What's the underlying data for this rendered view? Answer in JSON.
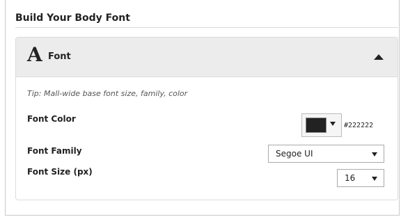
{
  "section": {
    "title": "Build Your Body Font"
  },
  "panel": {
    "icon_glyph": "A",
    "header_label": "Font",
    "tip": "Tip: Mall-wide base font size, family, color"
  },
  "fields": {
    "font_color": {
      "label": "Font Color",
      "value": "#222222"
    },
    "font_family": {
      "label": "Font Family",
      "value": "Segoe UI"
    },
    "font_size": {
      "label": "Font Size (px)",
      "value": "16"
    }
  },
  "icons": {
    "font_icon": "font-icon",
    "collapse": "caret-up-icon",
    "dropdown": "caret-down-icon"
  }
}
